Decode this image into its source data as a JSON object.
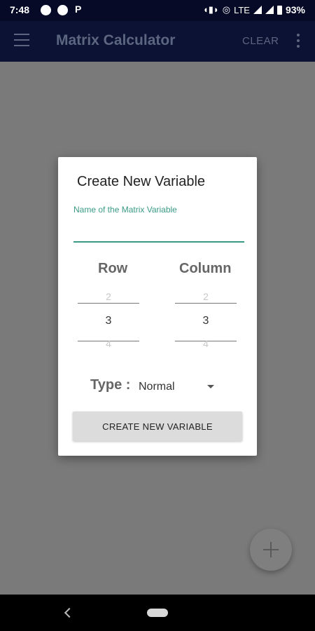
{
  "status_bar": {
    "time": "7:48",
    "notif_letter": "P",
    "network": "LTE",
    "battery": "93%"
  },
  "app_bar": {
    "title": "Matrix Calculator",
    "clear_label": "CLEAR",
    "icons": [
      "menu-icon",
      "overflow-icon"
    ]
  },
  "dialog": {
    "title": "Create New Variable",
    "name_field": {
      "label": "Name of the Matrix Variable",
      "value": "",
      "placeholder": ""
    },
    "row": {
      "heading": "Row",
      "prev": "2",
      "current": "3",
      "next": "4"
    },
    "column": {
      "heading": "Column",
      "prev": "2",
      "current": "3",
      "next": "4"
    },
    "type": {
      "label": "Type :",
      "selected": "Normal"
    },
    "create_button": "CREATE NEW VARIABLE"
  },
  "fab": {
    "icon": "plus-icon"
  },
  "nav_bar": {
    "icons": [
      "back-icon",
      "home-pill"
    ]
  },
  "colors": {
    "accent": "#3a9a86",
    "app_bar": "#0c1233",
    "scrim": "#7a7a7a"
  }
}
